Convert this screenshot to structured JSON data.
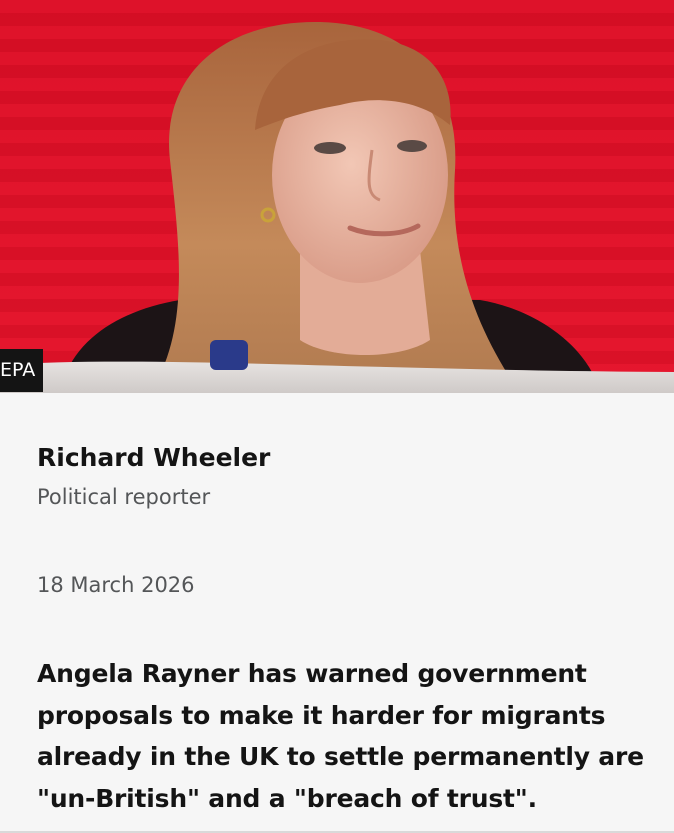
{
  "image": {
    "credit": "EPA",
    "description_icon": "portrait-photo"
  },
  "byline": {
    "author": "Richard Wheeler",
    "role": "Political reporter"
  },
  "date": "18 March 2026",
  "lead": "Angela Rayner has warned government proposals to make it harder for migrants already in the UK to settle permanently are \"un-British\" and a \"breach of trust\".",
  "colors": {
    "background_red": "#e0142c",
    "page_background": "#f6f6f6",
    "text_primary": "#141414",
    "text_secondary": "#545658"
  }
}
